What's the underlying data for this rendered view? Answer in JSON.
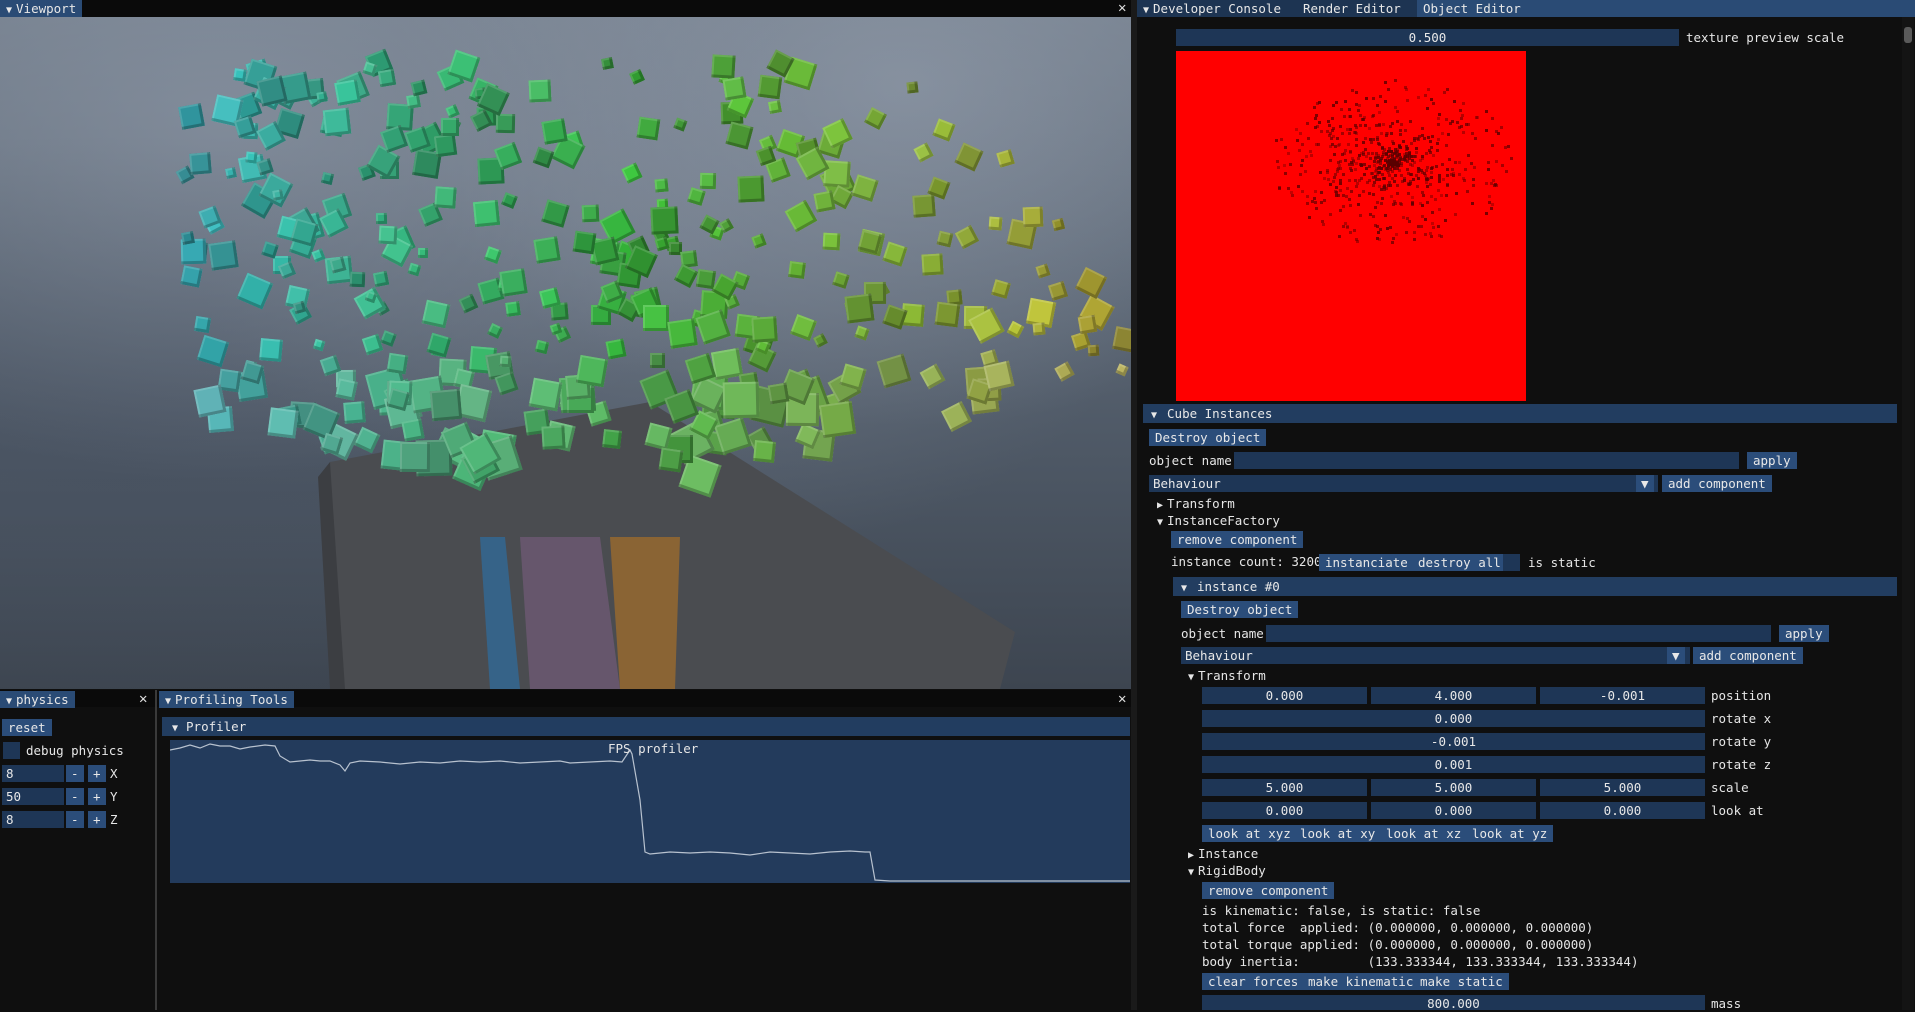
{
  "viewport": {
    "title": "Viewport"
  },
  "physics": {
    "title": "physics",
    "reset_label": "reset",
    "debug_label": "debug physics",
    "rows": [
      {
        "value": "8",
        "axis": "X"
      },
      {
        "value": "50",
        "axis": "Y"
      },
      {
        "value": "8",
        "axis": "Z"
      }
    ],
    "minus": "-",
    "plus": "+"
  },
  "profiling": {
    "title": "Profiling Tools",
    "section": "Profiler",
    "graph_label": "FPS profiler"
  },
  "right_tabs": [
    "Developer Console",
    "Render Editor",
    "Object Editor"
  ],
  "texture": {
    "scale_value": "0.500",
    "scale_label": "texture preview scale",
    "preview_color": "#ff0000"
  },
  "cube_instances": {
    "title": "Cube Instances",
    "destroy_label": "Destroy object",
    "object_name_label": "object name",
    "apply_label": "apply",
    "behaviour_value": "Behaviour",
    "add_component_label": "add component",
    "transform_label": "Transform",
    "factory_label": "InstanceFactory",
    "remove_component_label": "remove component",
    "instance_count_text": "instance count: 3200",
    "instanciate_label": "instanciate",
    "destroy_all_label": "destroy all",
    "is_static_label": "is static"
  },
  "instance0": {
    "title": "instance #0",
    "destroy_label": "Destroy object",
    "object_name_label": "object name",
    "apply_label": "apply",
    "behaviour_value": "Behaviour",
    "add_component_label": "add component",
    "transform_label": "Transform",
    "position": [
      "0.000",
      "4.000",
      "-0.001"
    ],
    "position_label": "position",
    "rotate_x": "0.000",
    "rotate_x_label": "rotate x",
    "rotate_y": "-0.001",
    "rotate_y_label": "rotate y",
    "rotate_z": "0.001",
    "rotate_z_label": "rotate z",
    "scale": [
      "5.000",
      "5.000",
      "5.000"
    ],
    "scale_label": "scale",
    "look_at": [
      "0.000",
      "0.000",
      "0.000"
    ],
    "look_at_label": "look at",
    "look_buttons": [
      "look at xyz",
      "look at xy",
      "look at xz",
      "look at yz"
    ],
    "instance_label": "Instance",
    "rigidbody_label": "RigidBody",
    "remove_component_label": "remove component",
    "kinematic_text": "is kinematic: false, is static: false",
    "force_text": "total force  applied: (0.000000, 0.000000, 0.000000)",
    "torque_text": "total torque applied: (0.000000, 0.000000, 0.000000)",
    "inertia_text": "body inertia:         (133.333344, 133.333344, 133.333344)",
    "clear_forces_label": "clear forces",
    "make_kinematic_label": "make kinematic",
    "make_static_label": "make static",
    "mass_value": "800.000",
    "mass_label": "mass"
  },
  "icons": [
    "close-icon",
    "collapse-triangle-icon",
    "expand-triangle-icon"
  ]
}
